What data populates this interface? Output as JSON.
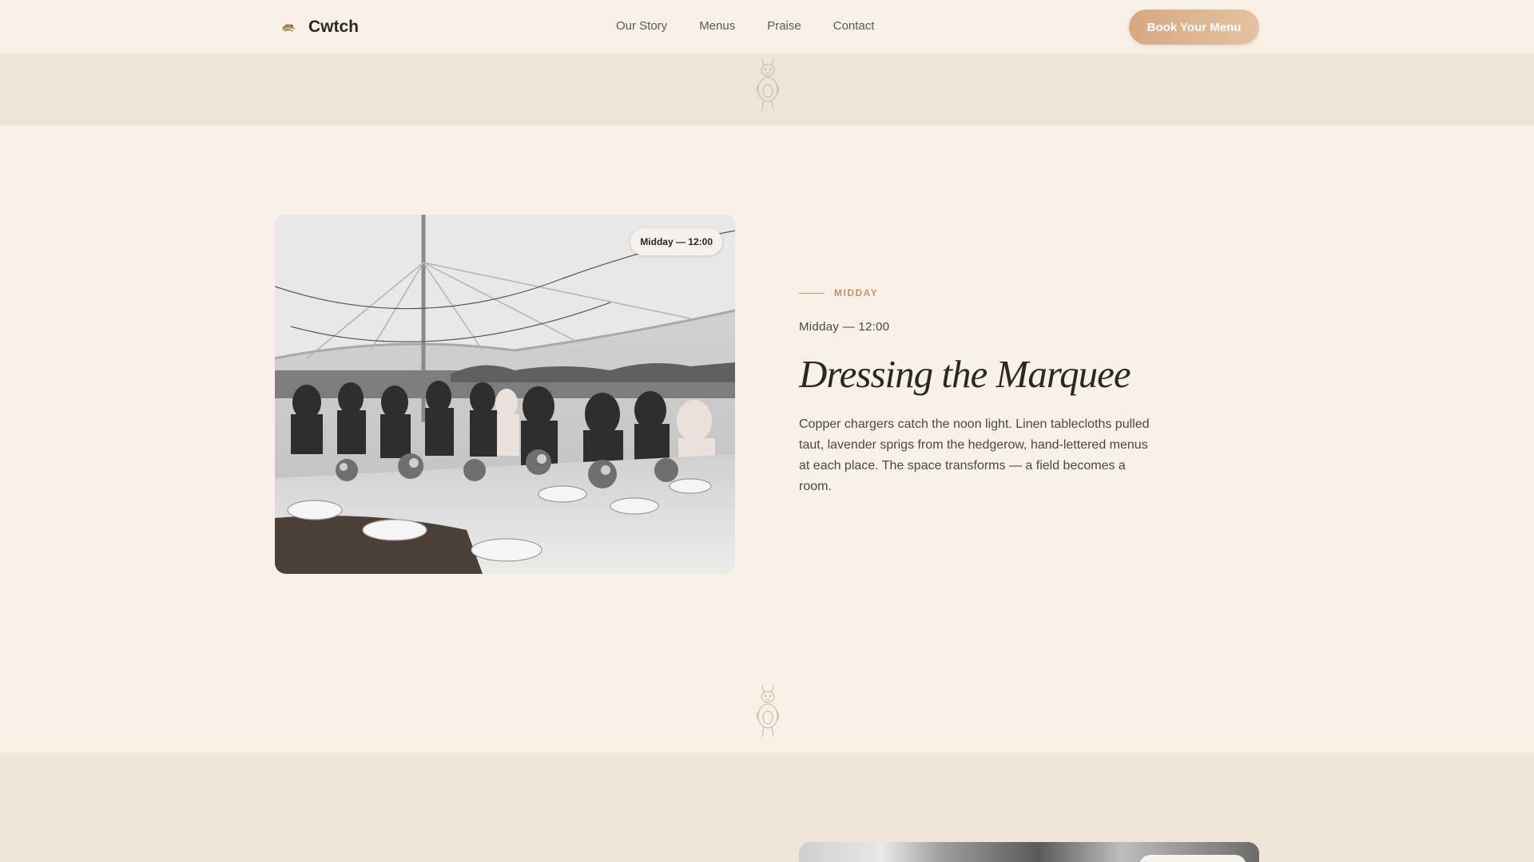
{
  "header": {
    "brand": "Cwtch",
    "nav": [
      "Our Story",
      "Menus",
      "Praise",
      "Contact"
    ],
    "cta_label": "Book Your Menu"
  },
  "feature": {
    "photo_badge": "Midday — 12:00",
    "eyebrow": "MIDDAY",
    "time": "Midday — 12:00",
    "title": "Dressing the Marquee",
    "description": "Copper chargers catch the noon light. Linen tablecloths pulled taut, lavender sprigs from the hedgerow, hand-lettered menus at each place. The space transforms — a field becomes a room."
  },
  "colors": {
    "background": "#f8f1e8",
    "band": "#efe5d6",
    "accent": "#d5a982",
    "eyebrow": "#c39468"
  },
  "icons": {
    "logo": "cwtch-logo-icon",
    "divider": "mascot-icon"
  }
}
